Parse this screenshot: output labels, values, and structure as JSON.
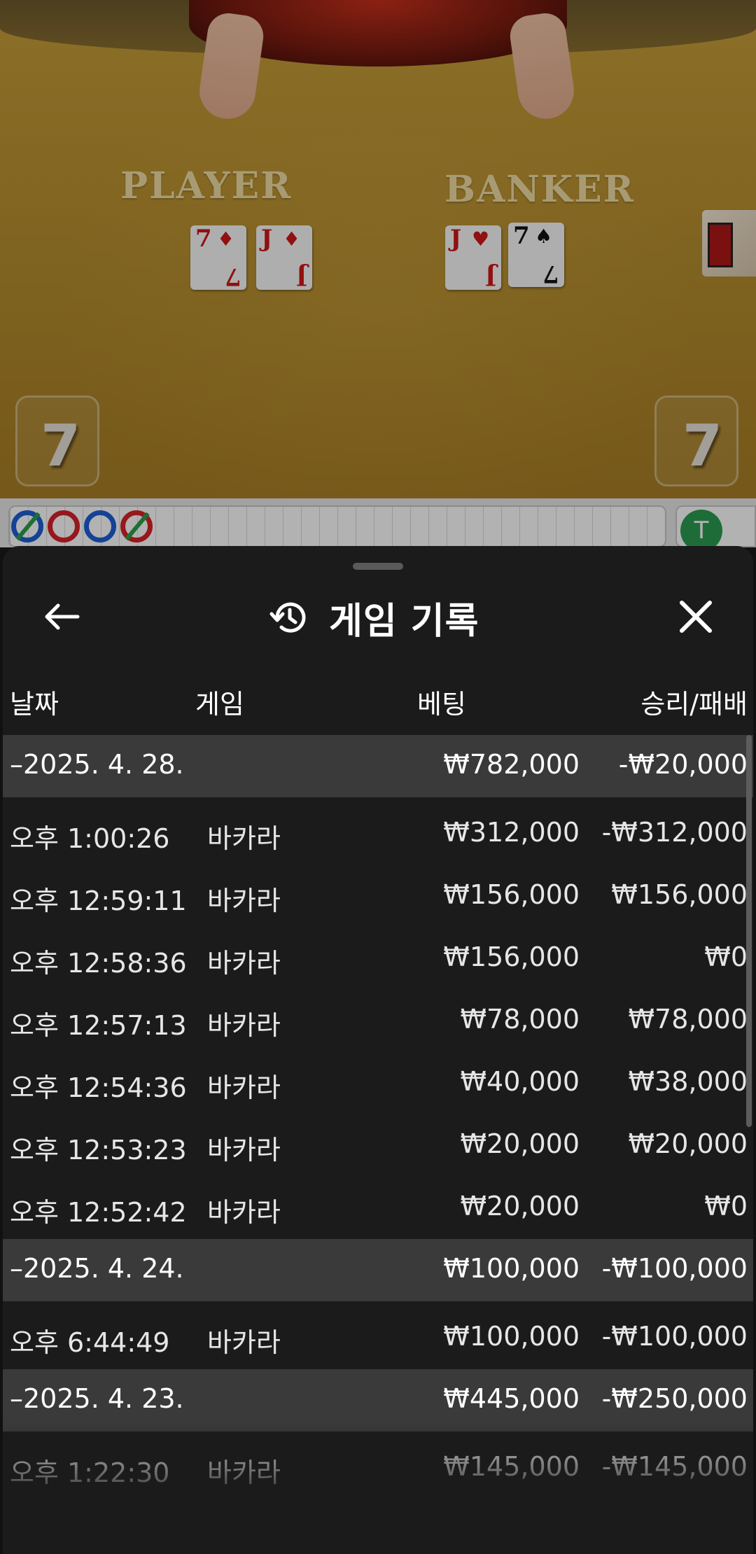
{
  "video": {
    "player_label": "PLAYER",
    "banker_label": "BANKER",
    "player_cards": [
      {
        "rank": "7",
        "suit": "♦",
        "color": "#d01818"
      },
      {
        "rank": "J",
        "suit": "♦",
        "color": "#d01818"
      }
    ],
    "banker_cards": [
      {
        "rank": "J",
        "suit": "♥",
        "color": "#d01818"
      },
      {
        "rank": "7",
        "suit": "♠",
        "color": "#141414"
      }
    ],
    "player_score": "7",
    "banker_score": "7"
  },
  "road": {
    "tie_badge": "T"
  },
  "sheet": {
    "back_icon": "arrow-left-icon",
    "history_icon": "history-icon",
    "close_icon": "close-icon",
    "title": "게임 기록",
    "headers": {
      "date": "날짜",
      "game": "게임",
      "bet": "베팅",
      "result": "승리/패배"
    },
    "groups": [
      {
        "date": "–2025. 4. 28.",
        "bet": "₩782,000",
        "result": "-₩20,000",
        "rows": [
          {
            "time": "오후 1:00:26",
            "game": "바카라",
            "bet": "₩312,000",
            "result": "-₩312,000"
          },
          {
            "time": "오후 12:59:11",
            "game": "바카라",
            "bet": "₩156,000",
            "result": "₩156,000"
          },
          {
            "time": "오후 12:58:36",
            "game": "바카라",
            "bet": "₩156,000",
            "result": "₩0"
          },
          {
            "time": "오후 12:57:13",
            "game": "바카라",
            "bet": "₩78,000",
            "result": "₩78,000"
          },
          {
            "time": "오후 12:54:36",
            "game": "바카라",
            "bet": "₩40,000",
            "result": "₩38,000"
          },
          {
            "time": "오후 12:53:23",
            "game": "바카라",
            "bet": "₩20,000",
            "result": "₩20,000"
          },
          {
            "time": "오후 12:52:42",
            "game": "바카라",
            "bet": "₩20,000",
            "result": "₩0"
          }
        ]
      },
      {
        "date": "–2025. 4. 24.",
        "bet": "₩100,000",
        "result": "-₩100,000",
        "rows": [
          {
            "time": "오후 6:44:49",
            "game": "바카라",
            "bet": "₩100,000",
            "result": "-₩100,000"
          }
        ]
      },
      {
        "date": "–2025. 4. 23.",
        "bet": "₩445,000",
        "result": "-₩250,000",
        "rows": [
          {
            "time": "오후 1:22:30",
            "game": "바카라",
            "bet": "₩145,000",
            "result": "-₩145,000"
          }
        ]
      }
    ]
  }
}
